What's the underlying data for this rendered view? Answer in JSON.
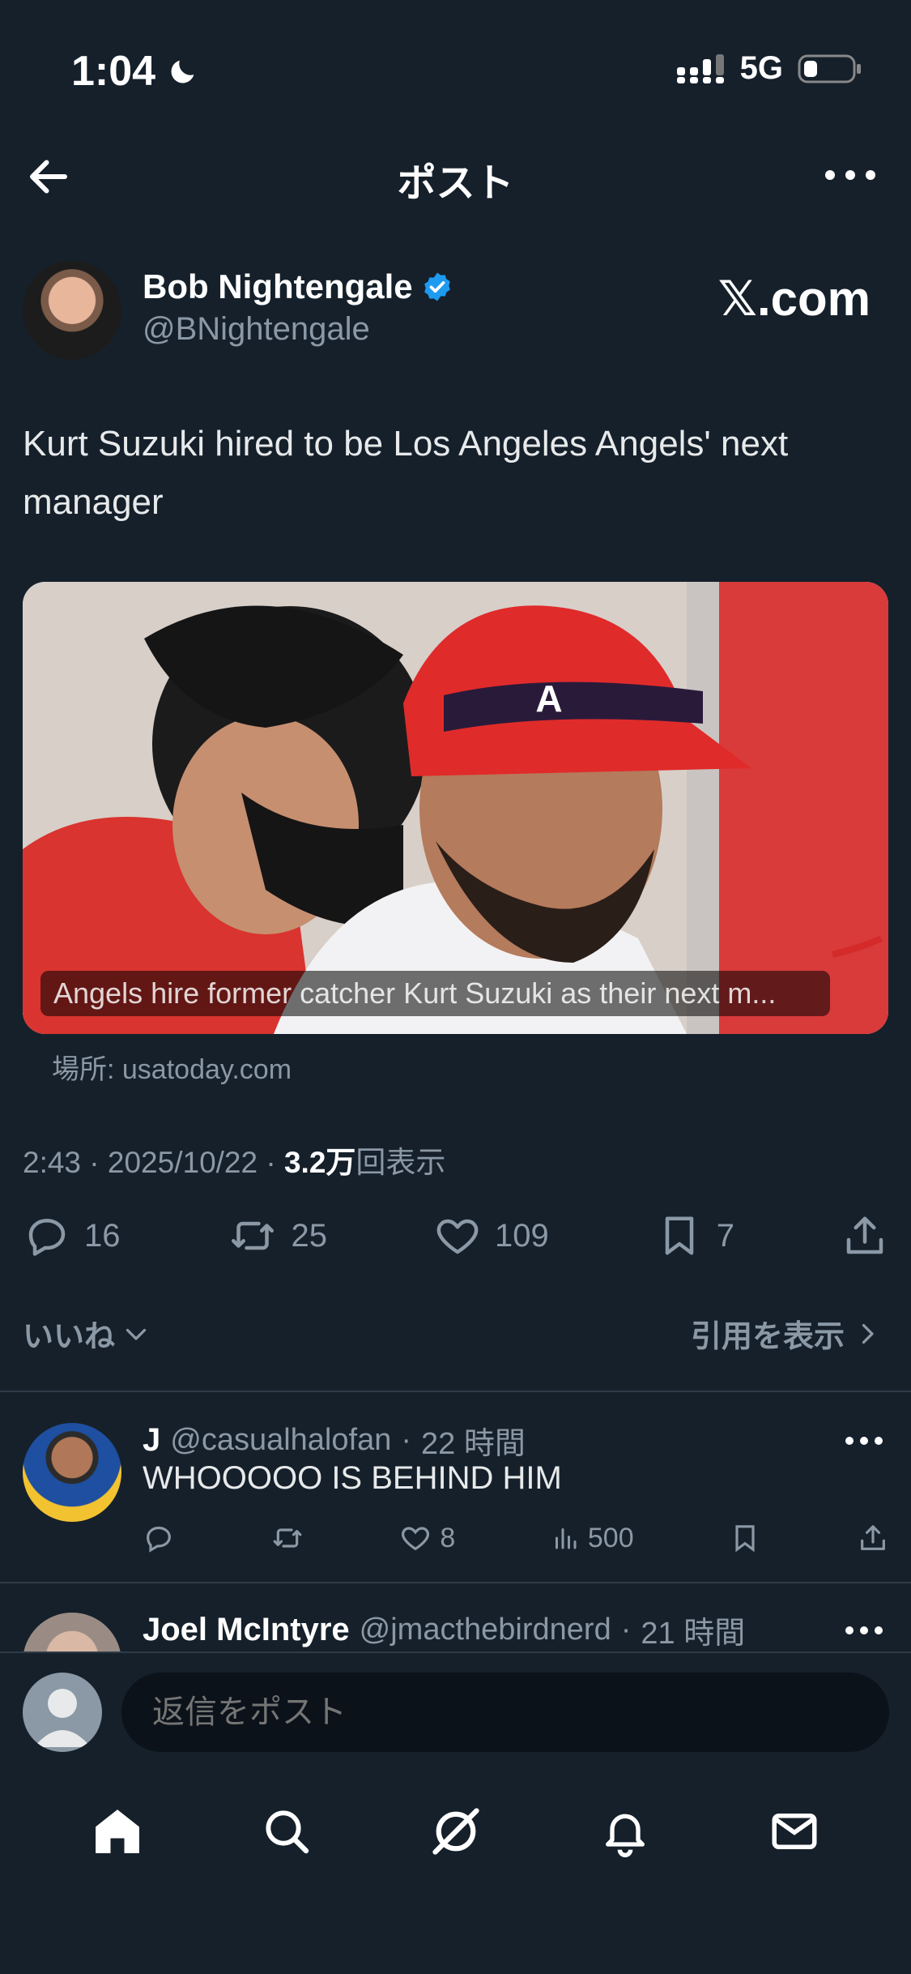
{
  "status_bar": {
    "time": "1:04",
    "network": "5G"
  },
  "header": {
    "title": "ポスト"
  },
  "post": {
    "author_name": "Bob Nightengale",
    "author_handle": "@BNightengale",
    "brand": "𝕏.com",
    "text": "Kurt Suzuki hired to be Los Angeles Angels' next manager",
    "link_card": {
      "caption": "Angels hire former catcher Kurt Suzuki as their next m...",
      "source": "場所: usatoday.com"
    },
    "meta": {
      "time": "2:43",
      "date": "2025/10/22",
      "views_number": "3.2万",
      "views_suffix": "回表示"
    },
    "actions": {
      "replies": "16",
      "reposts": "25",
      "likes": "109",
      "bookmarks": "7"
    },
    "likes_label": "いいね",
    "quotes_label": "引用を表示"
  },
  "replies": [
    {
      "name": "J",
      "handle": "@casualhalofan",
      "time": "22 時間",
      "text": "WHOOOOO IS BEHIND HIM",
      "likes": "8",
      "views": "500"
    },
    {
      "name": "Joel McIntyre",
      "handle": "@jmacthebirdnerd",
      "time": "21 時間"
    }
  ],
  "composer": {
    "placeholder": "返信をポスト"
  },
  "colors": {
    "background": "#15202b",
    "verified": "#1d9bf0",
    "muted": "#8b98a5"
  }
}
